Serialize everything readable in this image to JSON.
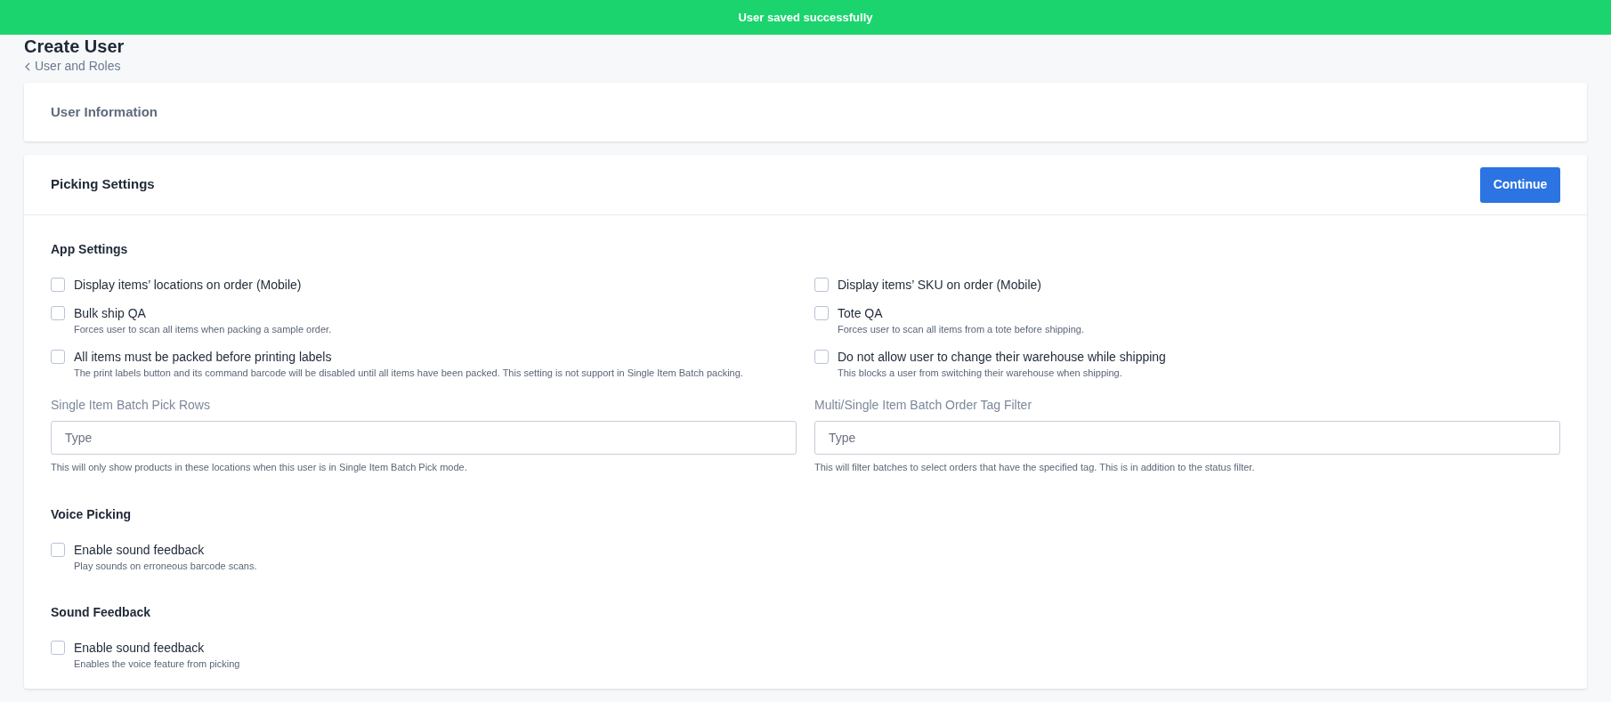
{
  "toast": {
    "message": "User saved successfully"
  },
  "page": {
    "title": "Create User",
    "breadcrumb": "User and Roles"
  },
  "user_information": {
    "title": "User Information"
  },
  "picking_settings": {
    "title": "Picking Settings",
    "continue_button": "Continue",
    "groups": [
      {
        "title": "App Settings",
        "options": [
          {
            "label": "Display items’ locations on order (Mobile)",
            "checked": false
          },
          {
            "label": "Display items’ SKU on order (Mobile)",
            "checked": false
          },
          {
            "label": "Bulk ship QA",
            "help": "Forces user to scan all items when packing a sample order.",
            "checked": false
          },
          {
            "label": "Tote QA",
            "help": "Forces user to scan all items from a tote before shipping.",
            "checked": false
          },
          {
            "label": "All items must be packed before printing labels",
            "help": "The print labels button and its command barcode will be disabled until all items have been packed. This setting is not support in Single Item Batch packing.",
            "checked": false
          },
          {
            "label": "Do not allow user to change their warehouse while shipping",
            "help": "This blocks a user from switching their warehouse when shipping.",
            "checked": false
          }
        ],
        "fields": [
          {
            "label": "Single Item Batch Pick Rows",
            "placeholder": "Type",
            "help": "This will only show products in these locations when this user is in Single Item Batch Pick mode."
          },
          {
            "label": "Multi/Single Item Batch Order Tag Filter",
            "placeholder": "Type",
            "help": "This will filter batches to select orders that have the specified tag. This is in addition to the status filter."
          }
        ]
      },
      {
        "title": "Voice Picking",
        "options": [
          {
            "label": "Enable sound feedback",
            "help": "Play sounds on erroneous barcode scans.",
            "checked": false
          }
        ]
      },
      {
        "title": "Sound Feedback",
        "options": [
          {
            "label": "Enable sound feedback",
            "help": "Enables the voice feature from picking",
            "checked": false
          }
        ]
      }
    ]
  }
}
